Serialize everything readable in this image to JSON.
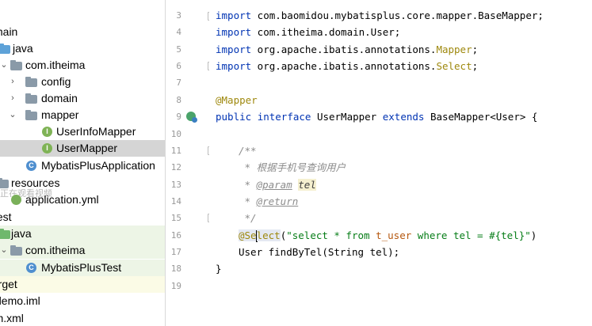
{
  "project_tree": {
    "items": [
      {
        "label": "main",
        "icon": "folder-icon",
        "indent": 0
      },
      {
        "label": "java",
        "icon": "source-folder-icon",
        "indent": 1
      },
      {
        "label": "com.itheima",
        "icon": "package-icon",
        "indent": 2
      },
      {
        "label": "config",
        "icon": "package-icon",
        "indent": 3
      },
      {
        "label": "domain",
        "icon": "package-icon",
        "indent": 3
      },
      {
        "label": "mapper",
        "icon": "package-icon",
        "indent": 3
      },
      {
        "label": "UserInfoMapper",
        "icon": "interface-icon",
        "indent": 4
      },
      {
        "label": "UserMapper",
        "icon": "interface-icon",
        "indent": 4
      },
      {
        "label": "MybatisPlusApplication",
        "icon": "spring-class-icon",
        "indent": 3
      },
      {
        "label": "resources",
        "icon": "resources-folder-icon",
        "indent": 1
      },
      {
        "label": "application.yml",
        "icon": "yml-file-icon",
        "indent": 2
      },
      {
        "label": "test",
        "icon": "folder-icon",
        "indent": 0
      },
      {
        "label": "java",
        "icon": "test-source-folder-icon",
        "indent": 1
      },
      {
        "label": "com.itheima",
        "icon": "package-icon",
        "indent": 2
      },
      {
        "label": "MybatisPlusTest",
        "icon": "spring-class-icon",
        "indent": 3
      },
      {
        "label": "target",
        "icon": "folder-icon",
        "indent": 0
      },
      {
        "label": "demo.iml",
        "icon": "iml-file-icon",
        "indent": 0
      },
      {
        "label": "pom.xml",
        "icon": "maven-file-icon",
        "indent": 0
      }
    ],
    "overlay_text": "正在观看视频"
  },
  "editor": {
    "line_numbers": [
      "3",
      "4",
      "5",
      "6",
      "7",
      "8",
      "9",
      "10",
      "11",
      "12",
      "13",
      "14",
      "15",
      "16",
      "17",
      "18",
      "19"
    ],
    "code": {
      "l3": {
        "kw": "import",
        "rest": " com.baomidou.mybatisplus.core.mapper.BaseMapper;"
      },
      "l4": {
        "kw": "import",
        "rest": " com.itheima.domain.User;"
      },
      "l5": {
        "kw": "import",
        "pre": " org.apache.ibatis.annotations.",
        "ann": "Mapper",
        "post": ";"
      },
      "l6": {
        "kw": "import",
        "pre": " org.apache.ibatis.annotations.",
        "ann": "Select",
        "post": ";"
      },
      "l8": {
        "ann": "@Mapper"
      },
      "l9": {
        "kw1": "public",
        "kw2": "interface",
        "name": "UserMapper",
        "kw3": "extends",
        "rest": "BaseMapper<User> {"
      },
      "l11": {
        "text": "/**"
      },
      "l12": {
        "text": " * 根据手机号查询用户"
      },
      "l13": {
        "star": " * ",
        "tag": "@param",
        "param": "tel"
      },
      "l14": {
        "star": " * ",
        "tag": "@return"
      },
      "l15": {
        "text": " */"
      },
      "l16": {
        "ann_a": "@Se",
        "ann_b": "lect",
        "p1": "(",
        "s1": "\"select * from ",
        "tbl": "t_user",
        "s2": " where tel = #{tel}\"",
        "p2": ")"
      },
      "l17": {
        "text": "User findByTel(String tel);"
      },
      "l18": {
        "text": "}"
      }
    }
  }
}
